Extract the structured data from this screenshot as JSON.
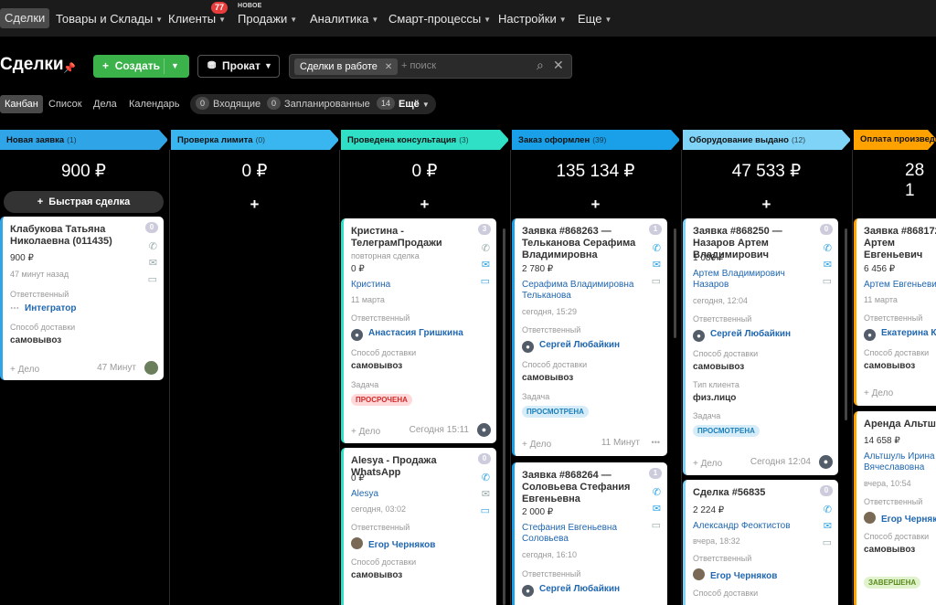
{
  "nav": {
    "items": [
      {
        "label": "Сделки"
      },
      {
        "label": "Товары и Склады"
      },
      {
        "label": "Клиенты"
      },
      {
        "label": "Продажи"
      },
      {
        "label": "Аналитика"
      },
      {
        "label": "Смарт-процессы"
      },
      {
        "label": "Настройки"
      },
      {
        "label": "Еще"
      }
    ],
    "clients_badge": "77",
    "new_label": "НОВОЕ"
  },
  "header": {
    "title": "Сделки",
    "create_label": "Создать",
    "rent_label": "Прокат",
    "filter_chip": "Сделки в работе",
    "search_placeholder": "+ поиск"
  },
  "views": {
    "tabs": [
      "Канбан",
      "Список",
      "Дела",
      "Календарь"
    ],
    "incoming_count": "0",
    "incoming_label": "Входящие",
    "planned_count": "0",
    "planned_label": "Запланированные",
    "more_count": "14",
    "more_label": "Ещё"
  },
  "columns": [
    {
      "name": "Новая заявка",
      "count": "(1)",
      "sum": "900 ₽",
      "color": "#2fa4e7",
      "quick_deal": "Быстрая сделка"
    },
    {
      "name": "Проверка лимита",
      "count": "(0)",
      "sum": "0 ₽",
      "color": "#39b6f0"
    },
    {
      "name": "Проведена консультация",
      "count": "(3)",
      "sum": "0 ₽",
      "color": "#2fe0c6"
    },
    {
      "name": "Заказ оформлен",
      "count": "(39)",
      "sum": "135 134 ₽",
      "color": "#1aa0e8"
    },
    {
      "name": "Оборудование выдано",
      "count": "(12)",
      "sum": "47 533 ₽",
      "color": "#7fd3f7"
    },
    {
      "name": "Оплата произведе",
      "count": "",
      "sum": "28 1",
      "color": "#ffa200"
    }
  ],
  "cards": {
    "c1": {
      "title": "Клабукова Татьяна Николаевна (011435)",
      "amount": "900 ₽",
      "time": "47 минут назад",
      "resp_label": "Ответственный",
      "resp": "Интегратор",
      "delivery_label": "Способ доставки",
      "delivery": "самовывоз",
      "add": "+ Дело",
      "foot": "47 Минут",
      "count": "0"
    },
    "c2": {
      "title": "Кристина - ТелеграмПродажи",
      "sub": "повторная сделка",
      "amount": "0 ₽",
      "client": "Кристина",
      "date": "11 марта",
      "resp_label": "Ответственный",
      "resp": "Анастасия Гришкина",
      "delivery_label": "Способ доставки",
      "delivery": "самовывоз",
      "task_label": "Задача",
      "task": "ПРОСРОЧЕНА",
      "add": "+ Дело",
      "foot": "Сегодня 15:11",
      "count": "3"
    },
    "c3": {
      "title": "Alesya - Продажа WhatsApp",
      "amount": "0 ₽",
      "client": "Alesya",
      "date": "сегодня, 03:02",
      "resp_label": "Ответственный",
      "resp": "Егор Черняков",
      "delivery_label": "Способ доставки",
      "delivery": "самовывоз",
      "count": "0"
    },
    "c4": {
      "title": "Заявка #868263 — Тельканова Серафима Владимировна",
      "amount": "2 780 ₽",
      "client": "Серафима Владимировна Тельканова",
      "date": "сегодня, 15:29",
      "resp_label": "Ответственный",
      "resp": "Сергей Любайкин",
      "delivery_label": "Способ доставки",
      "delivery": "самовывоз",
      "task_label": "Задача",
      "task": "ПРОСМОТРЕНА",
      "add": "+ Дело",
      "foot": "11 Минут",
      "count": "1"
    },
    "c5": {
      "title": "Заявка #868264 — Соловьева Стефания Евгеньевна",
      "amount": "2 000 ₽",
      "client": "Стефания Евгеньевна Соловьева",
      "date": "сегодня, 16:10",
      "resp_label": "Ответственный",
      "resp": "Сергей Любайкин",
      "count": "1"
    },
    "c6": {
      "title": "Заявка #868250 — Назаров Артем Владимирович",
      "amount": "1 080 ₽",
      "client": "Артем Владимирович Назаров",
      "date": "сегодня, 12:04",
      "resp_label": "Ответственный",
      "resp": "Сергей Любайкин",
      "delivery_label": "Способ доставки",
      "delivery": "самовывоз",
      "type_label": "Тип клиента",
      "type": "физ.лицо",
      "task_label": "Задача",
      "task": "ПРОСМОТРЕНА",
      "add": "+ Дело",
      "foot": "Сегодня 12:04",
      "count": "0"
    },
    "c7": {
      "title": "Сделка #56835",
      "amount": "2 224 ₽",
      "client": "Александр Феоктистов",
      "date": "вчера, 18:32",
      "resp_label": "Ответственный",
      "resp": "Егор Черняков",
      "delivery_label": "Способ доставки",
      "count": "0"
    },
    "c8": {
      "title": "Заявка #868172 - Артем Евгеньевич",
      "amount": "6 456 ₽",
      "client": "Артем Евгеньевич",
      "date": "11 марта",
      "resp_label": "Ответственный",
      "resp": "Екатерина Ка",
      "delivery_label": "Способ доставки",
      "delivery": "самовывоз",
      "add": "+ Дело"
    },
    "c9": {
      "title": "Аренда Альтшул",
      "amount": "14 658 ₽",
      "client": "Альтшуль Ирина Вячеславовна",
      "date": "вчера, 10:54",
      "resp_label": "Ответственный",
      "resp": "Егор Черняков",
      "delivery_label": "Способ доставки",
      "delivery": "самовывоз",
      "task": "ЗАВЕРШЕНА"
    }
  }
}
